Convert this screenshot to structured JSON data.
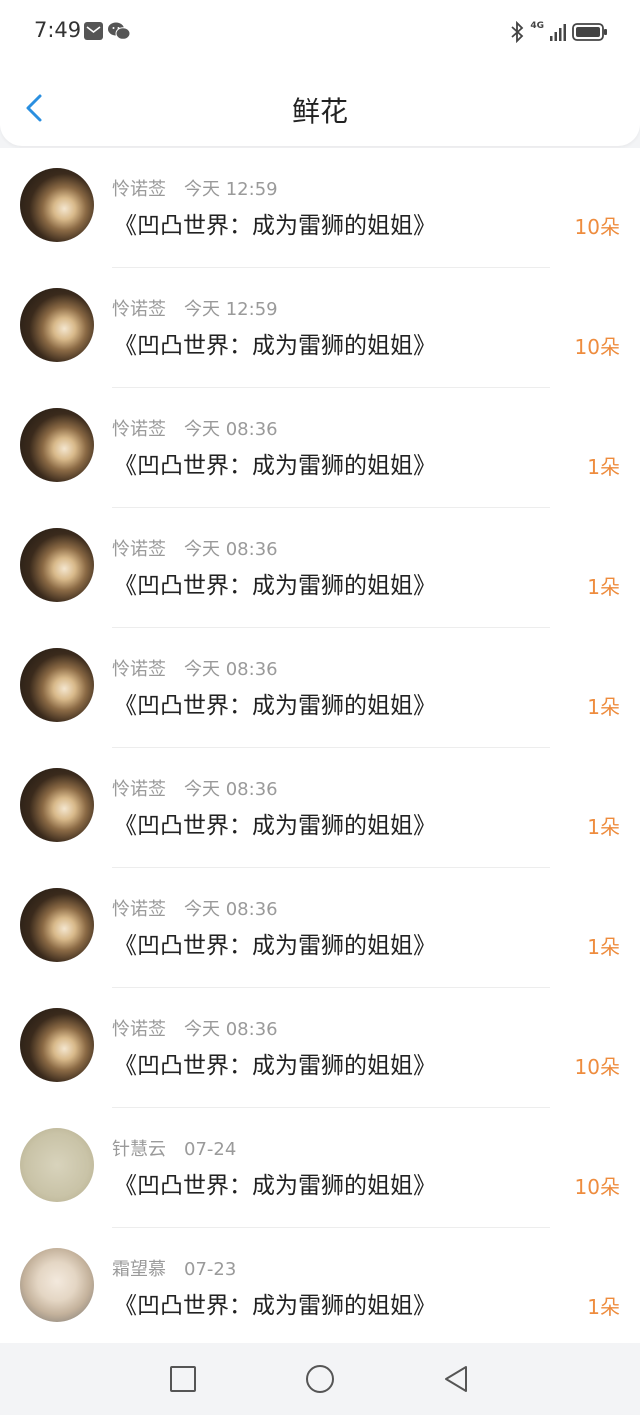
{
  "status_bar": {
    "time": "7:49",
    "network": "4G"
  },
  "header": {
    "title": "鲜花"
  },
  "records": [
    {
      "name": "怜诺莶",
      "time": "今天 12:59",
      "book": "《凹凸世界：成为雷狮的姐姐》",
      "count": "10朵",
      "avatar": "dark"
    },
    {
      "name": "怜诺莶",
      "time": "今天 12:59",
      "book": "《凹凸世界：成为雷狮的姐姐》",
      "count": "10朵",
      "avatar": "dark"
    },
    {
      "name": "怜诺莶",
      "time": "今天 08:36",
      "book": "《凹凸世界：成为雷狮的姐姐》",
      "count": "1朵",
      "avatar": "dark"
    },
    {
      "name": "怜诺莶",
      "time": "今天 08:36",
      "book": "《凹凸世界：成为雷狮的姐姐》",
      "count": "1朵",
      "avatar": "dark"
    },
    {
      "name": "怜诺莶",
      "time": "今天 08:36",
      "book": "《凹凸世界：成为雷狮的姐姐》",
      "count": "1朵",
      "avatar": "dark"
    },
    {
      "name": "怜诺莶",
      "time": "今天 08:36",
      "book": "《凹凸世界：成为雷狮的姐姐》",
      "count": "1朵",
      "avatar": "dark"
    },
    {
      "name": "怜诺莶",
      "time": "今天 08:36",
      "book": "《凹凸世界：成为雷狮的姐姐》",
      "count": "1朵",
      "avatar": "dark"
    },
    {
      "name": "怜诺莶",
      "time": "今天 08:36",
      "book": "《凹凸世界：成为雷狮的姐姐》",
      "count": "10朵",
      "avatar": "dark"
    },
    {
      "name": "针慧云",
      "time": "07-24",
      "book": "《凹凸世界：成为雷狮的姐姐》",
      "count": "10朵",
      "avatar": "note"
    },
    {
      "name": "霜望慕",
      "time": "07-23",
      "book": "《凹凸世界：成为雷狮的姐姐》",
      "count": "1朵",
      "avatar": "hood"
    }
  ],
  "colors": {
    "accent_back": "#2a8fe0",
    "count": "#ee8c3e",
    "meta": "#9a9a9a"
  },
  "nav": {
    "icons": [
      "recent-apps-icon",
      "home-icon",
      "back-icon"
    ]
  }
}
